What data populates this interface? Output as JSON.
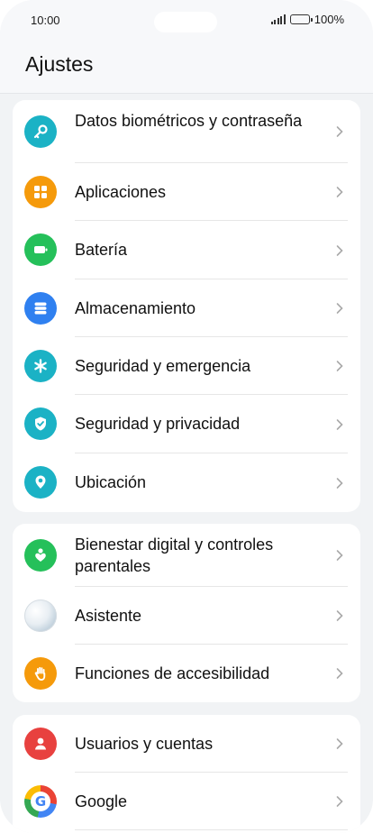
{
  "status_bar": {
    "time": "10:00",
    "battery": "100%"
  },
  "header": {
    "title": "Ajustes"
  },
  "groups": [
    {
      "items": [
        {
          "label": "Datos biométricos y contraseña",
          "icon": "key-icon",
          "color": "#1bb2c5"
        },
        {
          "label": "Aplicaciones",
          "icon": "apps-grid-icon",
          "color": "#f59a0b"
        },
        {
          "label": "Batería",
          "icon": "battery-icon",
          "color": "#25c05a"
        },
        {
          "label": "Almacenamiento",
          "icon": "storage-icon",
          "color": "#2f80f0"
        },
        {
          "label": "Seguridad y emergencia",
          "icon": "asterisk-icon",
          "color": "#1bb2c5"
        },
        {
          "label": "Seguridad y privacidad",
          "icon": "shield-check-icon",
          "color": "#1bb2c5"
        },
        {
          "label": "Ubicación",
          "icon": "location-pin-icon",
          "color": "#1bb2c5"
        }
      ]
    },
    {
      "items": [
        {
          "label": "Bienestar digital y controles parentales",
          "icon": "digital-wellbeing-icon",
          "color": "#25c05a"
        },
        {
          "label": "Asistente",
          "icon": "assistant-orb-icon",
          "color": "#dfe8ee"
        },
        {
          "label": "Funciones de accesibilidad",
          "icon": "hand-icon",
          "color": "#f59a0b"
        }
      ]
    },
    {
      "items": [
        {
          "label": "Usuarios y cuentas",
          "icon": "user-icon",
          "color": "#e8413f"
        },
        {
          "label": "Google",
          "icon": "google-icon",
          "color": "#4285f4"
        }
      ]
    }
  ]
}
